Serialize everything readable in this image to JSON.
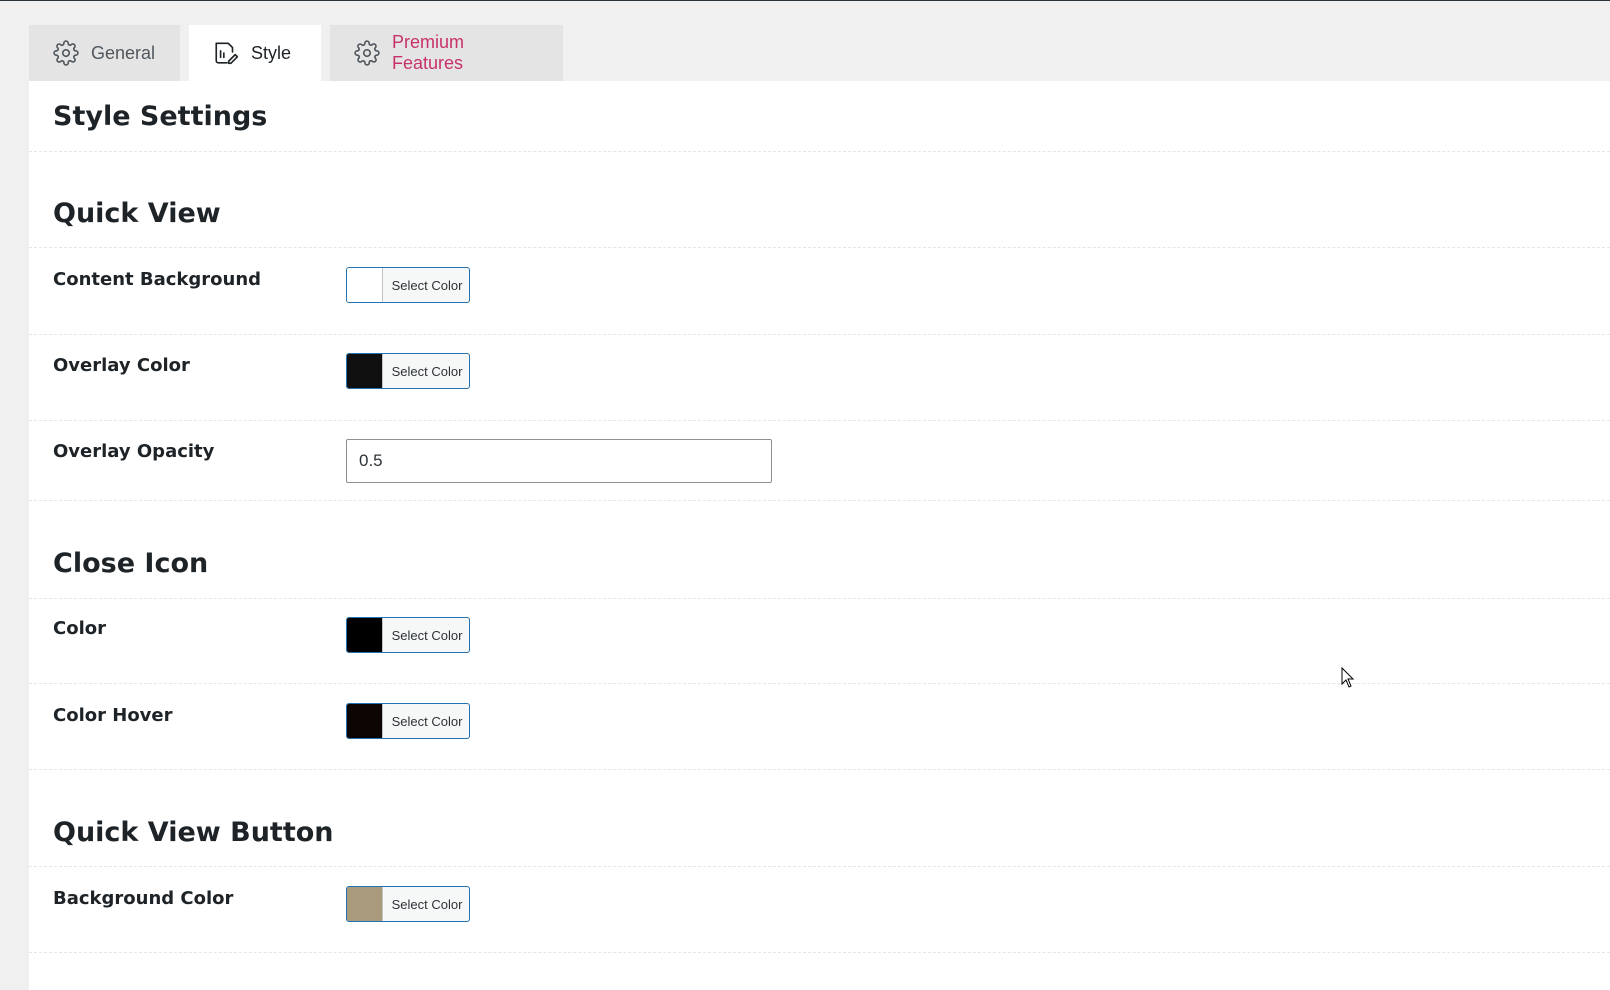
{
  "tabs": [
    {
      "label": "General",
      "icon": "gear-icon"
    },
    {
      "label": "Style",
      "icon": "style-edit-icon"
    },
    {
      "label": "Premium Features",
      "icon": "gear-icon",
      "color": "#c8316b"
    }
  ],
  "page_title": "Style Settings",
  "sections": {
    "quick_view": {
      "heading": "Quick View",
      "content_background": {
        "label": "Content Background",
        "button": "Select Color",
        "swatch": "#ffffff"
      },
      "overlay_color": {
        "label": "Overlay Color",
        "button": "Select Color",
        "swatch": "#0f0f0f"
      },
      "overlay_opacity": {
        "label": "Overlay Opacity",
        "value": "0.5"
      }
    },
    "close_icon": {
      "heading": "Close Icon",
      "color": {
        "label": "Color",
        "button": "Select Color",
        "swatch": "#000000"
      },
      "color_hover": {
        "label": "Color Hover",
        "button": "Select Color",
        "swatch": "#0d0404"
      }
    },
    "quick_view_button": {
      "heading": "Quick View Button",
      "background_color": {
        "label": "Background Color",
        "button": "Select Color",
        "swatch": "#a99a7c"
      }
    }
  }
}
